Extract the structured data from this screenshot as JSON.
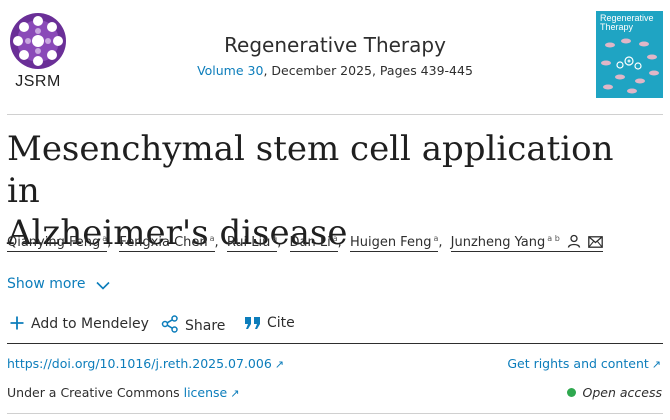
{
  "journal": {
    "logo_text": "JSRM",
    "title": "Regenerative Therapy",
    "volume": "Volume 30",
    "date_pages": ", December 2025, Pages 439-445",
    "cover_title_line1": "Regenerative",
    "cover_title_line2": "Therapy"
  },
  "article": {
    "title_line1": "Mesenchymal stem cell application in",
    "title_line2": "Alzheimer's disease"
  },
  "authors": [
    {
      "name": "Qianying Feng",
      "sup": "a"
    },
    {
      "name": "Fengxia Chen",
      "sup": "a"
    },
    {
      "name": "Rui Liu",
      "sup": "a"
    },
    {
      "name": "Dan Li",
      "sup": "a"
    },
    {
      "name": "Huigen Feng",
      "sup": "a"
    },
    {
      "name": "Junzheng Yang",
      "sup": "a b"
    }
  ],
  "show_more": "Show more",
  "actions": {
    "mendeley": "Add to Mendeley",
    "share": "Share",
    "cite": "Cite"
  },
  "links": {
    "doi": "https://doi.org/10.1016/j.reth.2025.07.006",
    "rights": "Get rights and content"
  },
  "license": {
    "prefix": "Under a Creative Commons ",
    "link": "license"
  },
  "open_access": "Open access",
  "colors": {
    "link": "#0c7dbb",
    "open_access_dot": "#2fa84f",
    "cover": "#1fa4c3",
    "logo": "#7b3fa6"
  },
  "icons": [
    "person-icon",
    "envelope-icon",
    "chevron-down-icon",
    "plus-icon",
    "share-icon",
    "cite-icon",
    "external-link-icon"
  ]
}
